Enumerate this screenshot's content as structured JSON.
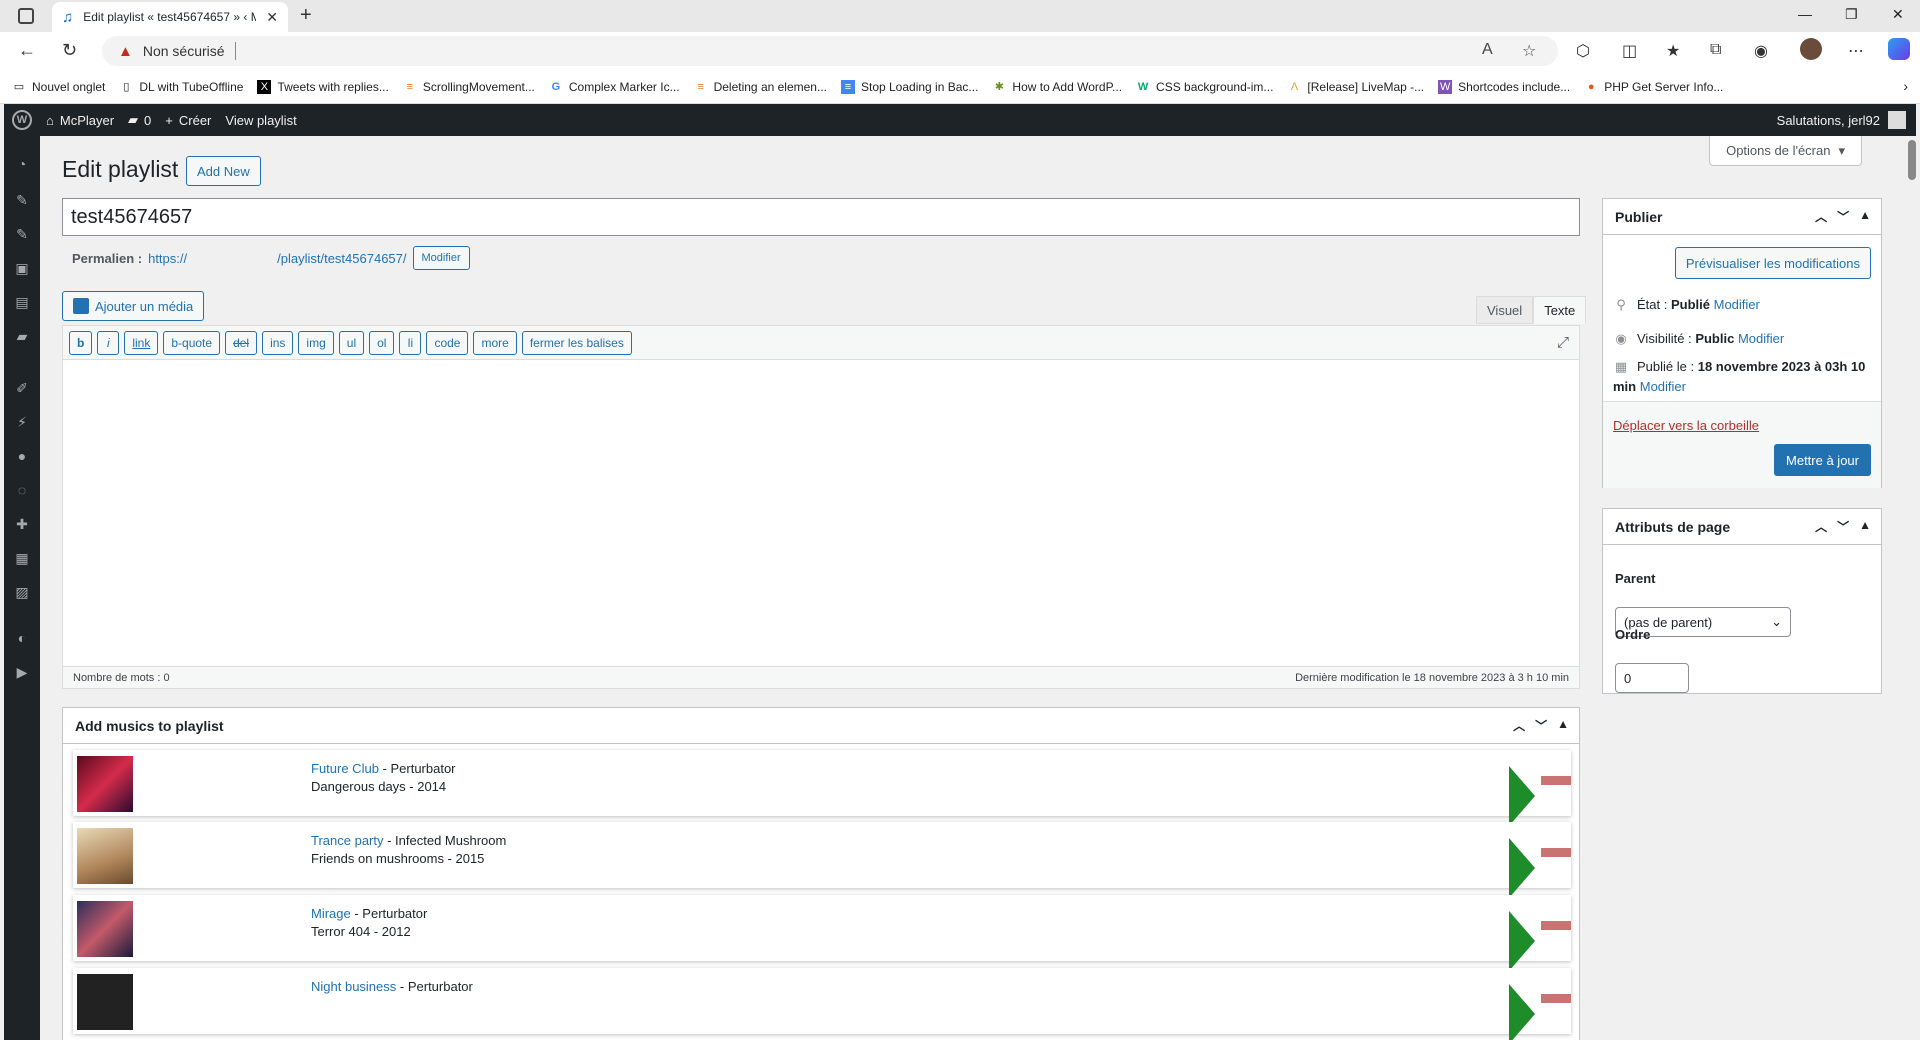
{
  "browser": {
    "tab_title": "Edit playlist « test45674657 » ‹ M",
    "tab_close": "✕",
    "new_tab": "+",
    "security_label": "Non sécurisé",
    "bookmarks": [
      {
        "label": "Nouvel onglet",
        "icon": "page-icon"
      },
      {
        "label": "DL with TubeOffline",
        "icon": "page-icon"
      },
      {
        "label": "Tweets with replies...",
        "icon": "x-icon"
      },
      {
        "label": "ScrollingMovement...",
        "icon": "stack-icon"
      },
      {
        "label": "Complex Marker Ic...",
        "icon": "google-icon"
      },
      {
        "label": "Deleting an elemen...",
        "icon": "stack-icon"
      },
      {
        "label": "Stop Loading in Bac...",
        "icon": "doc-icon"
      },
      {
        "label": "How to Add WordP...",
        "icon": "bug-icon"
      },
      {
        "label": "CSS background-im...",
        "icon": "w3-icon"
      },
      {
        "label": "[Release] LiveMap -...",
        "icon": "caret-icon"
      },
      {
        "label": "Shortcodes include...",
        "icon": "w-icon"
      },
      {
        "label": "PHP Get Server Info...",
        "icon": "dot-icon"
      }
    ]
  },
  "adminbar": {
    "site_name": "McPlayer",
    "comments_count": "0",
    "create_label": "Créer",
    "view_label": "View playlist",
    "greeting": "Salutations, jerl92"
  },
  "page": {
    "screen_options": "Options de l'écran",
    "title": "Edit playlist",
    "add_new": "Add New",
    "post_title": "test45674657",
    "permalink_label": "Permalien :",
    "permalink_prefix": "https://",
    "permalink_path": "/playlist/test45674657/",
    "permalink_edit": "Modifier",
    "add_media": "Ajouter un média",
    "tab_visual": "Visuel",
    "tab_text": "Texte",
    "qt_buttons": [
      "b",
      "i",
      "link",
      "b-quote",
      "del",
      "ins",
      "img",
      "ul",
      "ol",
      "li",
      "code",
      "more",
      "fermer les balises"
    ],
    "word_count": "Nombre de mots : 0",
    "last_modified": "Dernière modification le 18 novembre 2023 à 3 h 10 min"
  },
  "music_box": {
    "title": "Add musics to playlist",
    "items": [
      {
        "track": "Future Club",
        "artist": " - Perturbator",
        "album": "Dangerous days - 2014"
      },
      {
        "track": "Trance party",
        "artist": " - Infected Mushroom",
        "album": "Friends on mushrooms - 2015"
      },
      {
        "track": "Mirage",
        "artist": " - Perturbator",
        "album": "Terror 404 - 2012"
      },
      {
        "track": "Night business",
        "artist": " - Perturbator",
        "album": ""
      }
    ]
  },
  "publish": {
    "title": "Publier",
    "preview": "Prévisualiser les modifications",
    "status_label": "État :",
    "status_value": "Publié",
    "visibility_label": "Visibilité :",
    "visibility_value": "Public",
    "published_label": "Publié le :",
    "published_value": "18 novembre 2023 à 03h 10",
    "published_value2": "min",
    "edit": "Modifier",
    "trash": "Déplacer vers la corbeille",
    "update": "Mettre à jour"
  },
  "attributes": {
    "title": "Attributs de page",
    "parent_label": "Parent",
    "parent_value": "(pas de parent)",
    "order_label": "Ordre",
    "order_value": "0"
  },
  "colors": {
    "play": "#1f8c2a",
    "remove": "#c97373",
    "primary": "#2271b1",
    "adminbar": "#1d2327"
  }
}
